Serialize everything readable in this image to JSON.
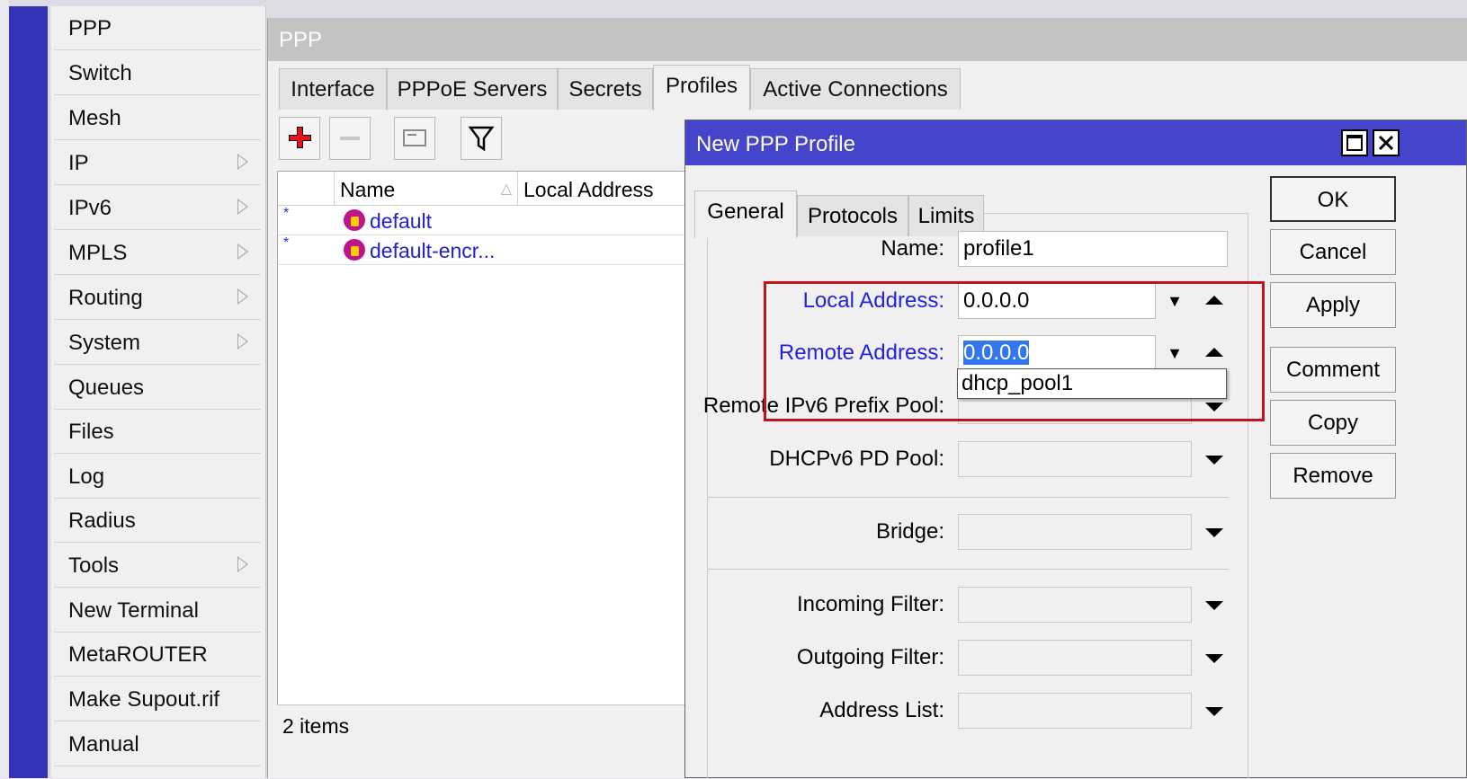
{
  "sidebar": {
    "items": [
      {
        "label": "PPP",
        "submenu": false
      },
      {
        "label": "Switch",
        "submenu": false
      },
      {
        "label": "Mesh",
        "submenu": false
      },
      {
        "label": "IP",
        "submenu": true
      },
      {
        "label": "IPv6",
        "submenu": true
      },
      {
        "label": "MPLS",
        "submenu": true
      },
      {
        "label": "Routing",
        "submenu": true
      },
      {
        "label": "System",
        "submenu": true
      },
      {
        "label": "Queues",
        "submenu": false
      },
      {
        "label": "Files",
        "submenu": false
      },
      {
        "label": "Log",
        "submenu": false
      },
      {
        "label": "Radius",
        "submenu": false
      },
      {
        "label": "Tools",
        "submenu": true
      },
      {
        "label": "New Terminal",
        "submenu": false
      },
      {
        "label": "MetaROUTER",
        "submenu": false
      },
      {
        "label": "Make Supout.rif",
        "submenu": false
      },
      {
        "label": "Manual",
        "submenu": false
      }
    ]
  },
  "ppp_window": {
    "title": "PPP",
    "tabs": [
      "Interface",
      "PPPoE Servers",
      "Secrets",
      "Profiles",
      "Active Connections"
    ],
    "active_tab": "Profiles",
    "toolbar": [
      "add-icon",
      "remove-icon",
      "comment-icon",
      "filter-icon"
    ],
    "table": {
      "columns": [
        "",
        "Name",
        "Local Address"
      ],
      "rows": [
        {
          "flag": "*",
          "name": "default"
        },
        {
          "flag": "*",
          "name": "default-encr..."
        }
      ]
    },
    "status": "2 items"
  },
  "dialog": {
    "title": "New PPP Profile",
    "tabs": [
      "General",
      "Protocols",
      "Limits"
    ],
    "active_tab": "General",
    "fields": {
      "name": {
        "label": "Name:",
        "value": "profile1"
      },
      "local_address": {
        "label": "Local Address:",
        "value": "0.0.0.0"
      },
      "remote_address": {
        "label": "Remote Address:",
        "value": "0.0.0.0"
      },
      "remote_ipv6_prefix_pool": {
        "label": "Remote IPv6 Prefix Pool:",
        "value": ""
      },
      "dhcpv6_pd_pool": {
        "label": "DHCPv6 PD Pool:",
        "value": ""
      },
      "bridge": {
        "label": "Bridge:",
        "value": ""
      },
      "incoming_filter": {
        "label": "Incoming Filter:",
        "value": ""
      },
      "outgoing_filter": {
        "label": "Outgoing Filter:",
        "value": ""
      },
      "address_list": {
        "label": "Address List:",
        "value": ""
      }
    },
    "dropdown_option": "dhcp_pool1",
    "buttons": {
      "ok": "OK",
      "cancel": "Cancel",
      "apply": "Apply",
      "comment": "Comment",
      "copy": "Copy",
      "remove": "Remove"
    },
    "highlight_color": "#c0141c",
    "title_color": "#4545cc"
  }
}
